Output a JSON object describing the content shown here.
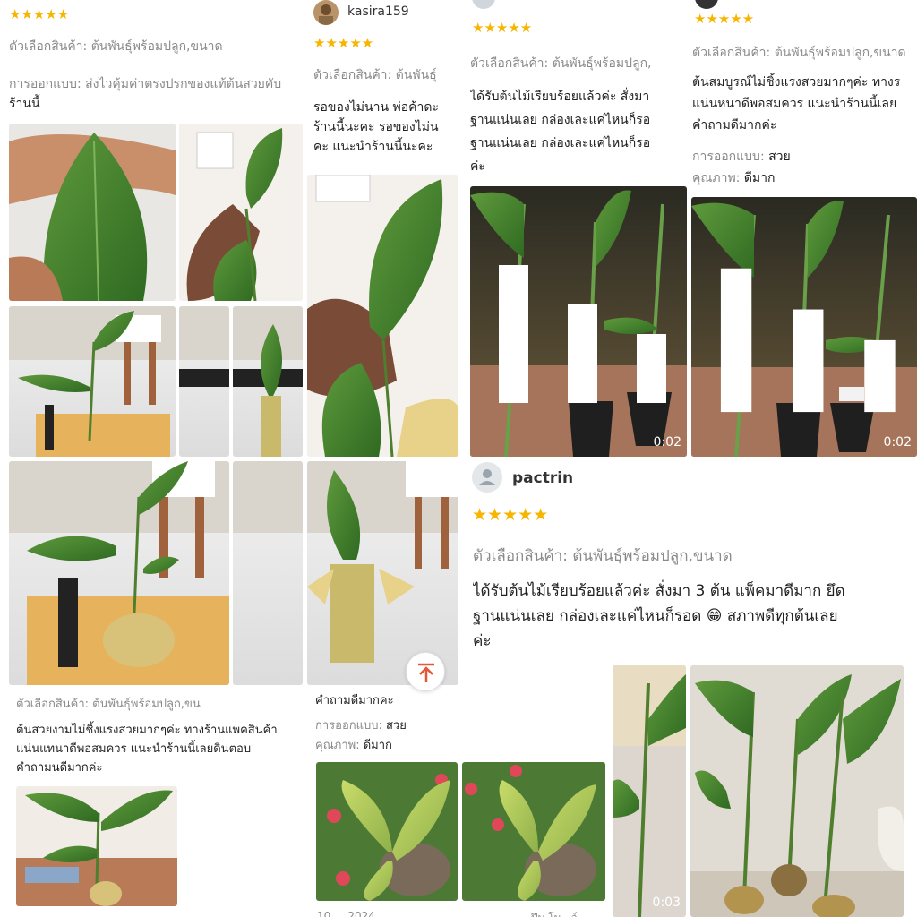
{
  "rating_glyph": "★★★★★",
  "c1": {
    "variant_label": "ตัวเลือกสินค้า: ต้นพันธุ์พร้อมปลูก,ขนาด",
    "design_line": "การออกแบบ: ส่งไวคุ้มค่าตรงปรกของแท้ต้นสวยคับ",
    "design_cont": "ร้านนี้",
    "variant2": "ตัวเลือกสินค้า: ต้นพันธุ์พร้อมปลูก,ขน",
    "review2": [
      "ต้นสวยงามไม่ชิ้งแรงสวยมากๆค่ะ ทางร้านแพคสินค้า",
      "แน่นแทนาดีพอสมควร แนะนำร้านนี้เลยดินตอบ",
      "คำถามนดีมากค่ะ"
    ]
  },
  "c2": {
    "username": "kasira159",
    "variant_label": "ตัวเลือกสินค้า: ต้นพันธุ์",
    "review": [
      "รอของไม่นาน พ่อค้าดะ",
      "ร้านนี้นะคะ รอของไม่น",
      "คะ แนะนำร้านนี้นะคะ"
    ],
    "tail_text": "คำถามดีมากคะ",
    "design_label": "การออกแบบ:",
    "design_value": "สวย",
    "quality_label": "คุณภาพ:",
    "quality_value": "ดีมาก",
    "date": "10 ... 2024"
  },
  "c3": {
    "variant_label": "ตัวเลือกสินค้า: ต้นพันธุ์พร้อมปลูก,",
    "review": [
      "ได้รับต้นไม้เรียบร้อยแล้วค่ะ สั่งมา",
      "ฐานแน่นเลย กล่องเละแค่ไหนก็รอ",
      "ฐานแน่นเลย กล่องเละแค่ไหนก็รอ",
      "ค่ะ"
    ],
    "video_duration": "0:02"
  },
  "c4": {
    "variant_label": "ตัวเลือกสินค้า: ต้นพันธุ์พร้อมปลูก,ขนาด",
    "review": [
      "ต้นสมบูรณ์ไม่ชิ้งแรงสวยมากๆค่ะ  ทางร",
      "แน่นหนาดีพอสมควร แนะนำร้านนี้เลย",
      "คำถามดีมากค่ะ"
    ],
    "design_label": "การออกแบบ:",
    "design_value": "สวย",
    "quality_label": "คุณภาพ:",
    "quality_value": "ดีมาก",
    "video_duration": "0:02"
  },
  "c5": {
    "username": "pactrin",
    "variant_label": "ตัวเลือกสินค้า: ต้นพันธุ์พร้อมปลูก,ขนาด",
    "review": [
      "ได้รับต้นไม้เรียบร้อยแล้วค่ะ สั่งมา 3 ต้น แพ็คมาดีมาก ยึด",
      "ฐานแน่นเลย กล่องเละแค่ไหนก็รอด 😁 สภาพดีทุกต้นเลย",
      "ค่ะ"
    ],
    "video_duration": "0:03",
    "footer_partial": "ปีบ โม...ว์ ..."
  },
  "colors": {
    "star": "#f7b500",
    "meta": "#8a8a8a",
    "text": "#222222"
  }
}
